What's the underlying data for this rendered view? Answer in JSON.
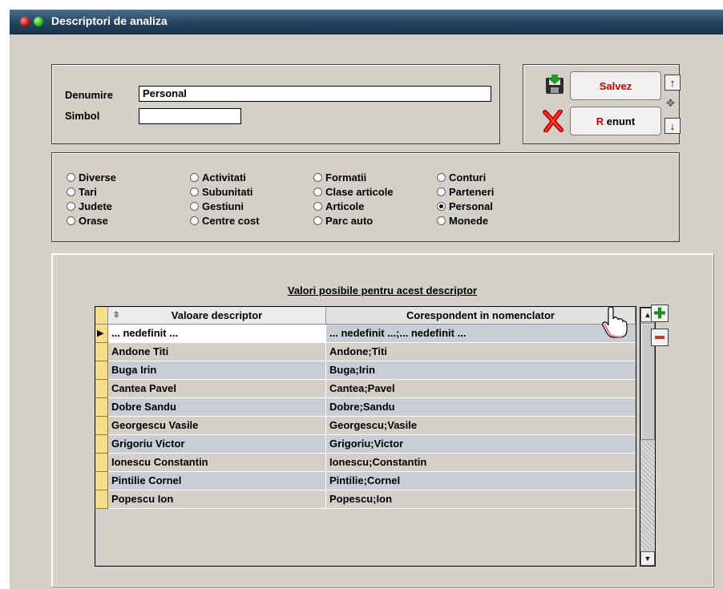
{
  "window": {
    "title": "Descriptori de analiza"
  },
  "form": {
    "denumire_label": "Denumire",
    "denumire_value": "Personal",
    "simbol_label": "Simbol",
    "simbol_value": ""
  },
  "buttons": {
    "save": "Salvez",
    "cancel": "Renunt"
  },
  "radios": [
    {
      "label": "Diverse",
      "checked": false
    },
    {
      "label": "Tari",
      "checked": false
    },
    {
      "label": "Judete",
      "checked": false
    },
    {
      "label": "Orase",
      "checked": false
    },
    {
      "label": "Activitati",
      "checked": false
    },
    {
      "label": "Subunitati",
      "checked": false
    },
    {
      "label": "Gestiuni",
      "checked": false
    },
    {
      "label": "Centre cost",
      "checked": false
    },
    {
      "label": "Formatii",
      "checked": false
    },
    {
      "label": "Clase articole",
      "checked": false
    },
    {
      "label": "Articole",
      "checked": false
    },
    {
      "label": "Parc auto",
      "checked": false
    },
    {
      "label": "Conturi",
      "checked": false
    },
    {
      "label": "Parteneri",
      "checked": false
    },
    {
      "label": "Personal",
      "checked": true
    },
    {
      "label": "Monede",
      "checked": false
    }
  ],
  "grid": {
    "caption": "Valori posibile pentru acest descriptor",
    "columns": [
      "Valoare descriptor",
      "Corespondent in nomenclator"
    ],
    "rows": [
      {
        "val": "... nedefinit ...",
        "cor": "... nedefinit ...;... nedefinit ..."
      },
      {
        "val": "Andone Titi",
        "cor": "Andone;Titi"
      },
      {
        "val": "Buga Irin",
        "cor": "Buga;Irin"
      },
      {
        "val": "Cantea Pavel",
        "cor": "Cantea;Pavel"
      },
      {
        "val": "Dobre Sandu",
        "cor": "Dobre;Sandu"
      },
      {
        "val": "Georgescu Vasile",
        "cor": "Georgescu;Vasile"
      },
      {
        "val": "Grigoriu Victor",
        "cor": "Grigoriu;Victor"
      },
      {
        "val": "Ionescu Constantin",
        "cor": "Ionescu;Constantin"
      },
      {
        "val": "Pintilie Cornel",
        "cor": "Pintilie;Cornel"
      },
      {
        "val": "Popescu Ion",
        "cor": "Popescu;Ion"
      }
    ]
  },
  "icons": {
    "save": "floppy-disk-icon",
    "cancel": "red-x-icon",
    "up": "arrow-up-icon",
    "down": "arrow-down-icon",
    "move": "move-icon",
    "add": "plus-icon",
    "remove": "minus-icon",
    "cursor": "hand-cursor-icon"
  },
  "colors": {
    "titlebar": "#24445f",
    "row_indicator": "#f5dd8b",
    "row_alt": "#c9cdd6",
    "plus": "#1f8a1f",
    "minus": "#d23a1a",
    "save_text": "#cc0000"
  }
}
